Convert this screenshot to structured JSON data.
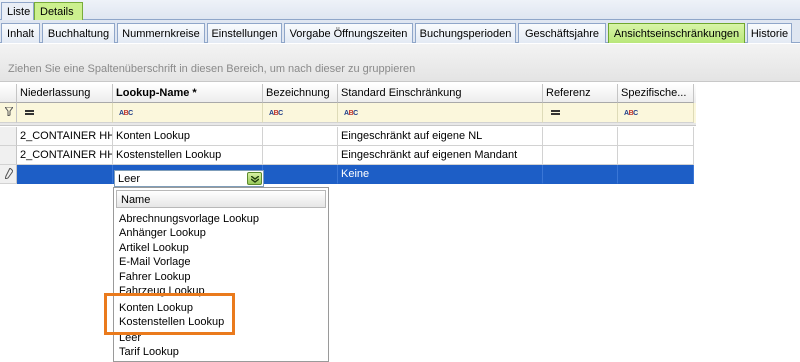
{
  "top_tabs": [
    {
      "label": "Liste"
    },
    {
      "label": "Details"
    }
  ],
  "sub_tabs": [
    {
      "label": "Inhalt"
    },
    {
      "label": "Buchhaltung"
    },
    {
      "label": "Nummernkreise"
    },
    {
      "label": "Einstellungen"
    },
    {
      "label": "Vorgabe Öffnungszeiten"
    },
    {
      "label": "Buchungsperioden"
    },
    {
      "label": "Geschäftsjahre"
    },
    {
      "label": "Ansichtseinschränkungen"
    },
    {
      "label": "Historie"
    }
  ],
  "active_sub_tab": "Ansichtseinschränkungen",
  "group_hint": "Ziehen Sie eine Spaltenüberschrift in diesen Bereich, um nach dieser zu gruppieren",
  "columns": [
    {
      "label": "Niederlassung",
      "filter": "equals"
    },
    {
      "label": "Lookup-Name *",
      "filter": "text"
    },
    {
      "label": "Bezeichnung",
      "filter": "text"
    },
    {
      "label": "Standard Einschränkung",
      "filter": "text"
    },
    {
      "label": "Referenz",
      "filter": "equals"
    },
    {
      "label": "Spezifische...",
      "filter": "text"
    }
  ],
  "rows": [
    {
      "niederlassung": "2_CONTAINER HH",
      "lookup": "Konten Lookup",
      "bezeichnung": "",
      "standard": "Eingeschränkt auf eigene NL",
      "referenz": "",
      "spezifisch": ""
    },
    {
      "niederlassung": "2_CONTAINER HH",
      "lookup": "Kostenstellen Lookup",
      "bezeichnung": "",
      "standard": "Eingeschränkt auf eigenen Mandant",
      "referenz": "",
      "spezifisch": ""
    }
  ],
  "edit_row": {
    "niederlassung": "",
    "lookup": "Leer",
    "standard": "Keine"
  },
  "dropdown": {
    "header": "Name",
    "items": [
      "Abrechnungsvorlage Lookup",
      "Anhänger Lookup",
      "Artikel Lookup",
      "E-Mail Vorlage",
      "Fahrer Lookup",
      "Fahrzeug Lookup",
      "Konten Lookup",
      "Kostenstellen Lookup",
      "Leer",
      "Tarif Lookup"
    ]
  },
  "colors": {
    "accent_green": "#b9e77a",
    "selection_blue": "#1d5ec6",
    "highlight_orange": "#ea7a1c"
  }
}
